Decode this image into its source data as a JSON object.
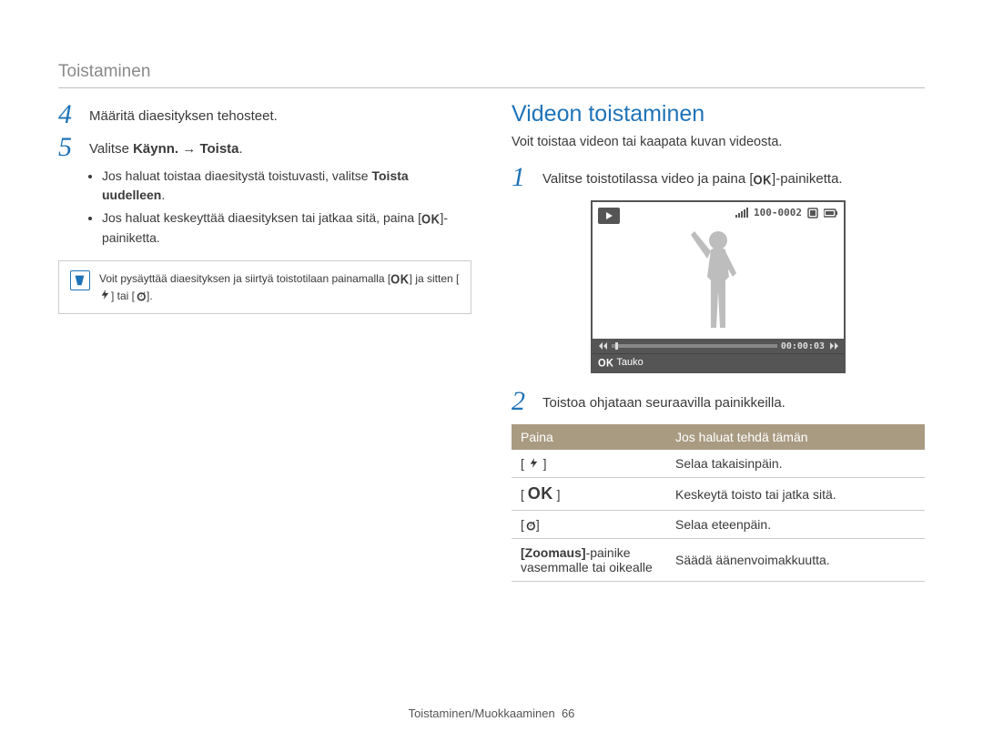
{
  "header": {
    "title": "Toistaminen"
  },
  "left": {
    "steps": [
      {
        "num": "4",
        "text": "Määritä diaesityksen tehosteet."
      },
      {
        "num": "5",
        "text_parts": [
          "Valitse ",
          {
            "b": "Käynn."
          },
          " → ",
          {
            "b": "Toista"
          },
          "."
        ]
      }
    ],
    "bullets": [
      {
        "parts": [
          "Jos haluat toistaa diaesitystä toistuvasti, valitse ",
          {
            "b": "Toista uudelleen"
          },
          "."
        ]
      },
      {
        "parts": [
          "Jos haluat keskeyttää diaesityksen tai jatkaa sitä, paina [",
          {
            "ok": true
          },
          "]-painiketta."
        ]
      }
    ],
    "note": {
      "parts": [
        "Voit pysäyttää diaesityksen ja siirtyä toistotilaan painamalla [",
        {
          "ok": true
        },
        "] ja sitten [",
        {
          "flash": true
        },
        "] tai [",
        {
          "timer": true
        },
        "]."
      ]
    }
  },
  "right": {
    "heading": "Videon toistaminen",
    "subtitle": "Voit toistaa videon tai kaapata kuvan videosta.",
    "step1": {
      "num": "1",
      "parts": [
        "Valitse toistotilassa video ja paina [",
        {
          "ok": true
        },
        "]-painiketta."
      ]
    },
    "preview": {
      "counter": "100-0002",
      "time": "00:00:03",
      "caption_ok": "OK",
      "caption_text": " Tauko"
    },
    "step2": {
      "num": "2",
      "text": "Toistoa ohjataan seuraavilla painikkeilla."
    },
    "table": {
      "headers": [
        "Paina",
        "Jos haluat tehdä tämän"
      ],
      "rows": [
        {
          "key_type": "flash",
          "desc": "Selaa takaisinpäin."
        },
        {
          "key_type": "ok",
          "desc": "Keskeytä toisto tai jatka sitä."
        },
        {
          "key_type": "timer",
          "desc": "Selaa eteenpäin."
        },
        {
          "key_type": "zoom",
          "key_label_parts": [
            {
              "b": "[Zoomaus]"
            },
            "-painike vasemmalle tai oikealle"
          ],
          "desc": "Säädä äänenvoimakkuutta."
        }
      ]
    }
  },
  "footer": {
    "section": "Toistaminen/Muokkaaminen",
    "page": "66"
  }
}
